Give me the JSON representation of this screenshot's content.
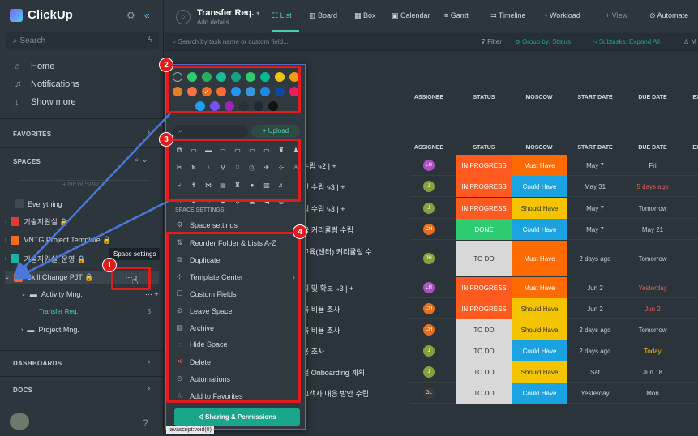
{
  "sidebar": {
    "logo": "ClickUp",
    "search_placeholder": "Search",
    "nav": [
      {
        "label": "Home",
        "icon": "home-icon"
      },
      {
        "label": "Notifications",
        "icon": "bell-icon"
      },
      {
        "label": "Show more",
        "icon": "arrow-down-icon"
      }
    ],
    "favorites": "FAVORITES",
    "spaces": "SPACES",
    "new_space": "+ NEW SPACE",
    "space_items": [
      {
        "label": "Everything",
        "color": "#3d4850"
      },
      {
        "label": "기술지원실 🔒",
        "color": "#e53935"
      },
      {
        "label": "VNTG Project Template 🔒",
        "color": "#f26b21"
      },
      {
        "label": "기술지원실_운영 🔒",
        "color": "#1bb3a1"
      },
      {
        "label": "Skill Change PJT 🔒",
        "color": "#f26b21"
      }
    ],
    "sub_items": [
      {
        "label": "Activity Mng."
      },
      {
        "label": "Transfer Req.",
        "count": "5"
      },
      {
        "label": "Project Mng."
      }
    ],
    "tooltip": "Space settings",
    "dashboards": "DASHBOARDS",
    "docs": "DOCS"
  },
  "topbar": {
    "title": "Transfer Req.",
    "subtitle": "Add details",
    "tabs": [
      "List",
      "Board",
      "Box",
      "Calendar",
      "Gantt",
      "Timeline",
      "Workload",
      "+ View",
      "Automate"
    ]
  },
  "filterbar": {
    "search_placeholder": "Search by task name or custom field...",
    "filter": "Filter",
    "group_by": "Group by: Status",
    "subtasks": "Subtasks: Expand All",
    "me": "M"
  },
  "table": {
    "headers": [
      "ASSIGNEE",
      "STATUS",
      "MOSCOW",
      "START DATE",
      "DUE DATE",
      "EX"
    ],
    "rows": [
      {
        "name": "수립 ⤷2 | +",
        "assignee": "LH",
        "avatar_color": "#b04fc4",
        "status": "IN PROGRESS",
        "status_color": "#ff5a1f",
        "moscow": "Must Have",
        "moscow_color": "#ff6b00",
        "start": "May 7",
        "due": "Fri",
        "due_color": "#c7ced3"
      },
      {
        "name": "안 수립 ⤷3 | +",
        "assignee": "J",
        "avatar_color": "#8aa03a",
        "status": "IN PROGRESS",
        "status_color": "#ff5a1f",
        "moscow": "Could Have",
        "moscow_color": "#1aa3e0",
        "start": "May 31",
        "due": "5 days ago",
        "due_color": "#e25c5c"
      },
      {
        "name": "점 수립 ⤷3 | +",
        "assignee": "J",
        "avatar_color": "#8aa03a",
        "status": "IN PROGRESS",
        "status_color": "#ff5a1f",
        "moscow": "Should Have",
        "moscow_color": "#f5c400",
        "start": "May 7",
        "due": "Tomorrow",
        "due_color": "#c7ced3"
      },
      {
        "name": "육 커리큘럼 수립",
        "assignee": "CH",
        "avatar_color": "#e86d1e",
        "status": "DONE",
        "status_color": "#2ecc71",
        "moscow": "Could Have",
        "moscow_color": "#1aa3e0",
        "start": "May 7",
        "due": "May 21",
        "due_color": "#c7ced3"
      },
      {
        "name": "교육(센터) 커리큘럼 수",
        "assignee": "JH",
        "avatar_color": "#8aa03a",
        "status": "TO DO",
        "status_color": "#d8d8d8",
        "moscow": "Must Have",
        "moscow_color": "#ff6b00",
        "start": "2 days ago",
        "due": "Tomorrow",
        "due_color": "#c7ced3"
      },
      {
        "name": "획 및 확보 ⤷3 | +",
        "assignee": "LH",
        "avatar_color": "#b04fc4",
        "status": "IN PROGRESS",
        "status_color": "#ff5a1f",
        "moscow": "Must Have",
        "moscow_color": "#ff6b00",
        "start": "Jun 2",
        "due": "Yesterday",
        "due_color": "#e25c5c"
      },
      {
        "name": "육 비용 조사",
        "assignee": "CH",
        "avatar_color": "#e86d1e",
        "status": "IN PROGRESS",
        "status_color": "#ff5a1f",
        "moscow": "Should Have",
        "moscow_color": "#f5c400",
        "start": "Jun 2",
        "due": "Jun 2",
        "due_color": "#e25c5c"
      },
      {
        "name": "육 비용 조사",
        "assignee": "CH",
        "avatar_color": "#e86d1e",
        "status": "TO DO",
        "status_color": "#d8d8d8",
        "moscow": "Should Have",
        "moscow_color": "#f5c400",
        "start": "2 days ago",
        "due": "Tomorrow",
        "due_color": "#c7ced3"
      },
      {
        "name": "용 조사",
        "assignee": "J",
        "avatar_color": "#8aa03a",
        "status": "TO DO",
        "status_color": "#d8d8d8",
        "moscow": "Could Have",
        "moscow_color": "#1aa3e0",
        "start": "2 days ago",
        "due": "Today",
        "due_color": "#f5c400"
      },
      {
        "name": "별 Onboarding 계획",
        "assignee": "J",
        "avatar_color": "#8aa03a",
        "status": "TO DO",
        "status_color": "#d8d8d8",
        "moscow": "Should Have",
        "moscow_color": "#f5c400",
        "start": "Sat",
        "due": "Jun 18",
        "due_color": "#c7ced3"
      },
      {
        "name": "고객사 대응 방안 수립",
        "assignee": "GL",
        "avatar_color": "#3a3a3a",
        "status": "TO DO",
        "status_color": "#d8d8d8",
        "moscow": "Could Have",
        "moscow_color": "#1aa3e0",
        "start": "Yesterday",
        "due": "Mon",
        "due_color": "#c7ced3"
      }
    ]
  },
  "popup": {
    "colors_row1": [
      "none",
      "#2ecc71",
      "#27ae60",
      "#1abc9c",
      "#16a085",
      "#2ecc71",
      "#00b894",
      "#f1c40f",
      "#f39c12"
    ],
    "colors_row2": [
      "#e67e22",
      "#ff7043",
      "selected",
      "#ff6b35",
      "#2196f3",
      "#3498db",
      "#1e88e5",
      "#0d47a1",
      "#e91e63"
    ],
    "colors_row3": [
      "#1da1f2",
      "#7c4dff",
      "#9c27b0",
      "#263238",
      "#1b2a33",
      "#111111"
    ],
    "selected_color": "#f26b21",
    "icon_search_placeholder": "",
    "upload": "+ Upload",
    "section_label": "SPACE SETTINGS",
    "space_settings": "Space settings",
    "menu": [
      {
        "label": "Reorder Folder & Lists A-Z",
        "icon": "sort-icon"
      },
      {
        "label": "Duplicate",
        "icon": "duplicate-icon"
      },
      {
        "label": "Template Center",
        "icon": "template-icon"
      },
      {
        "label": "Custom Fields",
        "icon": "custom-fields-icon"
      },
      {
        "label": "Leave Space",
        "icon": "leave-icon"
      },
      {
        "label": "Archive",
        "icon": "archive-icon"
      },
      {
        "label": "Hide Space",
        "icon": "hide-icon"
      },
      {
        "label": "Delete",
        "icon": "delete-icon"
      },
      {
        "label": "Automations",
        "icon": "automations-icon"
      },
      {
        "label": "Add to Favorites",
        "icon": "star-icon"
      }
    ],
    "share_button": "Sharing & Permissions",
    "statusbar": "javascript:void(0)"
  },
  "annotations": [
    "1",
    "2",
    "3",
    "4"
  ]
}
